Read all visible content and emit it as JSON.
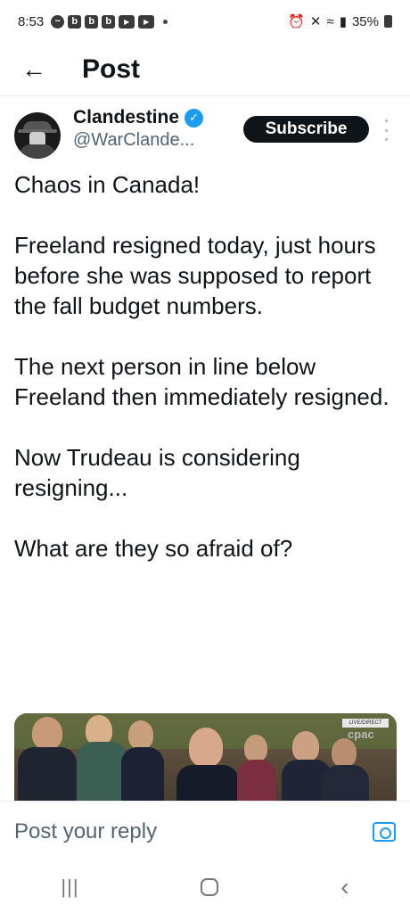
{
  "status_bar": {
    "time": "8:53",
    "notification_icons": [
      "messenger-icon",
      "b-icon",
      "b-icon",
      "b-icon",
      "video-icon",
      "video-icon"
    ],
    "battery_percent": "35%"
  },
  "header": {
    "back_icon": "←",
    "title": "Post"
  },
  "author": {
    "display_name": "Clandestine",
    "handle": "@WarClande...",
    "verified_mark": "✓",
    "subscribe_label": "Subscribe"
  },
  "post": {
    "paragraphs": [
      "Chaos in Canada!",
      "Freeland resigned today, just hours before she was supposed to report the fall budget numbers.",
      "The next person in line below Freeland then immediately resigned.",
      "Now Trudeau is considering resigning...",
      "What are they so afraid of?"
    ]
  },
  "media": {
    "live_badge": "LIVE/DIRECT",
    "channel": "cpac"
  },
  "reply": {
    "placeholder": "Post your reply"
  },
  "nav": {
    "recents": "|||",
    "back": "‹"
  },
  "colors": {
    "accent": "#1d9bf0",
    "text": "#0f1419",
    "secondary": "#536471"
  }
}
